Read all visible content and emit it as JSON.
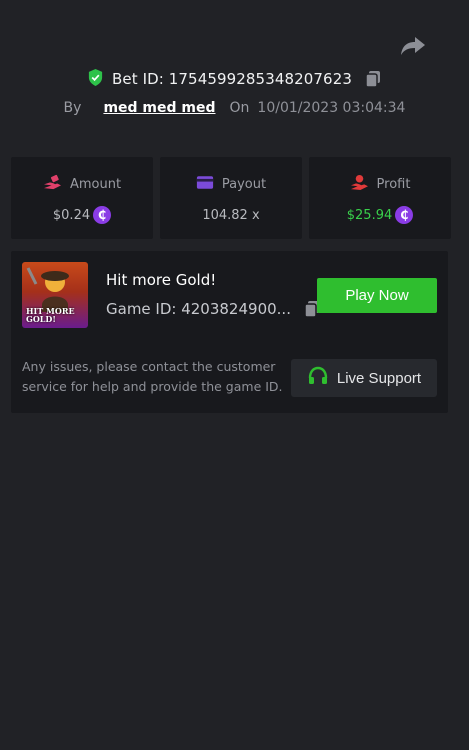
{
  "header": {
    "bet_id_label": "Bet ID: 1754599285348207623",
    "by_label": "By",
    "username": "med med med",
    "on_label": "On",
    "datetime": "10/01/2023 03:04:34"
  },
  "stats": {
    "amount": {
      "label": "Amount",
      "value": "$0.24",
      "icon": "amount-icon",
      "icon_color": "#e0406a"
    },
    "payout": {
      "label": "Payout",
      "value": "104.82 x",
      "icon": "payout-card-icon",
      "icon_color": "#7b4bd9"
    },
    "profit": {
      "label": "Profit",
      "value": "$25.94",
      "icon": "profit-icon",
      "icon_color": "#e03a3a",
      "value_color": "#39d04b"
    },
    "coin_symbol": "₵"
  },
  "game": {
    "thumbnail_text": "HIT MORE GOLD!",
    "title": "Hit more Gold!",
    "game_id_label": "Game ID: 4203824900...",
    "play_label": "Play Now",
    "help_text": "Any issues, please contact the customer service for help and provide the game ID.",
    "support_label": "Live Support"
  },
  "colors": {
    "background": "#212226",
    "card": "#18191d",
    "accent_green": "#2fbe2f",
    "coin_purple": "#8a3ce6"
  }
}
